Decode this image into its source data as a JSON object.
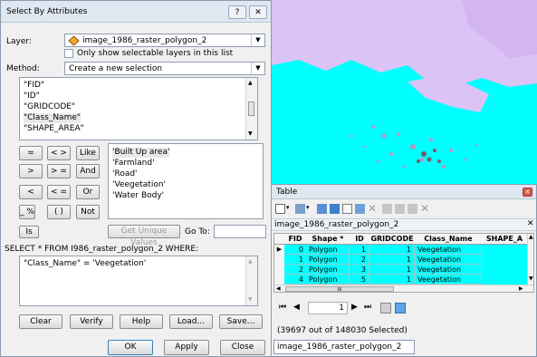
{
  "dialog": {
    "title": "Select By Attributes",
    "help_btn": "?",
    "close_btn": "✕",
    "layer_label": "Layer:",
    "layer_value": "image_1986_raster_polygon_2",
    "only_selectable_label": "Only show selectable layers in this list",
    "method_label": "Method:",
    "method_value": "Create a new selection",
    "fields": [
      "\"FID\"",
      "\"ID\"",
      "\"GRIDCODE\"",
      "\"Class_Name\"",
      "\"SHAPE_AREA\""
    ],
    "operators": [
      "=",
      "< >",
      "Like",
      ">",
      "> =",
      "And",
      "<",
      "< =",
      "Or",
      "_ %",
      "( )",
      "Not",
      "Is"
    ],
    "values": [
      "'Built Up area'",
      "'Farmland'",
      "'Road'",
      "'Veegetation'",
      "'Water Body'"
    ],
    "get_unique_values": "Get Unique Values",
    "go_to_label": "Go To:",
    "sql_prefix": "SELECT * FROM I986_raster_polygon_2 WHERE:",
    "sql_text": "\"Class_Name\" = 'Veegetation'",
    "clear": "Clear",
    "verify": "Verify",
    "help": "Help",
    "load": "Load...",
    "save": "Save...",
    "ok": "OK",
    "apply": "Apply",
    "close": "Close"
  },
  "table_window": {
    "title": "Table",
    "layer_name": "image_1986_raster_polygon_2",
    "columns": [
      "FID",
      "Shape *",
      "ID",
      "GRIDCODE",
      "Class_Name",
      "SHAPE_A"
    ],
    "rows": [
      [
        "0",
        "Polygon",
        "1",
        "1",
        "Veegetation",
        ""
      ],
      [
        "1",
        "Polygon",
        "2",
        "1",
        "Veegetation",
        ""
      ],
      [
        "2",
        "Polygon",
        "3",
        "1",
        "Veegetation",
        ""
      ],
      [
        "4",
        "Polygon",
        "5",
        "1",
        "Veegetation",
        ""
      ]
    ],
    "scroll_indicator": "III",
    "record_number": "1",
    "status": "(39697 out of 148030 Selected)",
    "tab_label": "image_1986_raster_polygon_2"
  },
  "colors": {
    "selection_cyan": "#00FFFF",
    "map_lavender": "#E0C0FF"
  }
}
